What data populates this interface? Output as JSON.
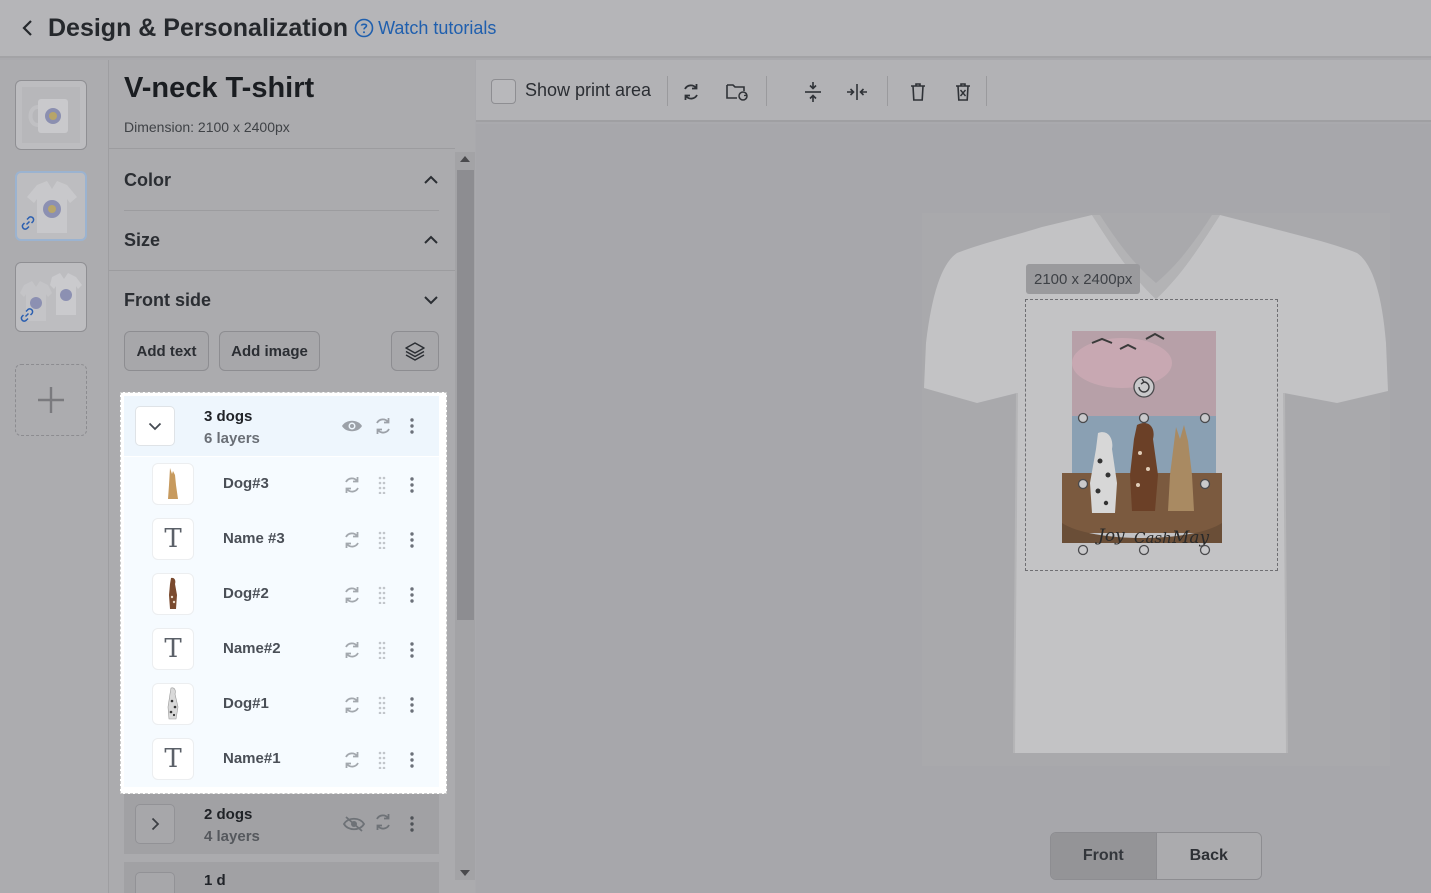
{
  "header": {
    "title": "Design & Personalization",
    "tutorial_link": "Watch tutorials"
  },
  "product": {
    "name": "V-neck T-shirt",
    "dimension": "Dimension: 2100 x 2400px"
  },
  "sections": {
    "color": "Color",
    "size": "Size",
    "front_side": "Front side"
  },
  "actions": {
    "add_text": "Add text",
    "add_image": "Add image"
  },
  "layer_groups": [
    {
      "name": "3 dogs",
      "count": "6 layers",
      "expanded": true,
      "visible": true,
      "layers": [
        {
          "name": "Dog#3",
          "kind": "image",
          "icon": "tan-dog-thumbnail"
        },
        {
          "name": "Name #3",
          "kind": "text",
          "icon": "text-icon"
        },
        {
          "name": "Dog#2",
          "kind": "image",
          "icon": "brown-dog-thumbnail"
        },
        {
          "name": "Name#2",
          "kind": "text",
          "icon": "text-icon"
        },
        {
          "name": "Dog#1",
          "kind": "image",
          "icon": "dalmatian-thumbnail"
        },
        {
          "name": "Name#1",
          "kind": "text",
          "icon": "text-icon"
        }
      ]
    },
    {
      "name": "2 dogs",
      "count": "4 layers",
      "expanded": false,
      "visible": false
    },
    {
      "name": "1 d",
      "count": "",
      "expanded": false
    }
  ],
  "toolbar": {
    "show_print_area": "Show print area",
    "show_print_area_checked": false
  },
  "canvas": {
    "dimension_tag": "2100 x 2400px",
    "artwork_names": [
      "Joy",
      "Cash",
      "May"
    ]
  },
  "view_toggle": {
    "front": "Front",
    "back": "Back",
    "active": "front"
  },
  "colors": {
    "accent_link": "#1f5fae",
    "overlay": "#a9a9ad",
    "highlight_bg": "#eef6fd"
  }
}
